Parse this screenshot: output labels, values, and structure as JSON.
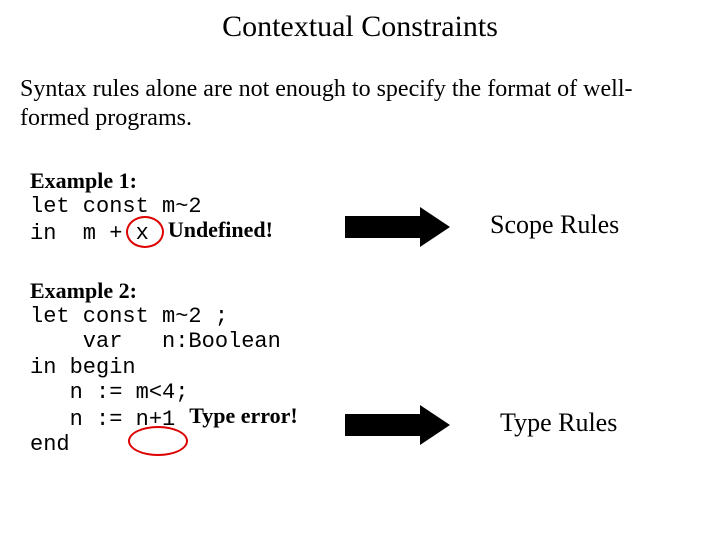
{
  "title": "Contextual Constraints",
  "intro": "Syntax rules alone are not enough to specify the format of well-formed programs.",
  "ex1": {
    "label": "Example 1:",
    "line1": "let const m~2",
    "line2a": "in  m + ",
    "line2b": "x",
    "annot": "Undefined!",
    "right": "Scope Rules"
  },
  "ex2": {
    "label": "Example 2:",
    "l1": "let const m~2 ;",
    "l2": "    var   n:Boolean",
    "l3": "in begin",
    "l4": "   n := m<4;",
    "l5a": "   n := ",
    "l5b": "n+1",
    "l6": "end",
    "annot": "Type error!",
    "right": "Type Rules"
  }
}
